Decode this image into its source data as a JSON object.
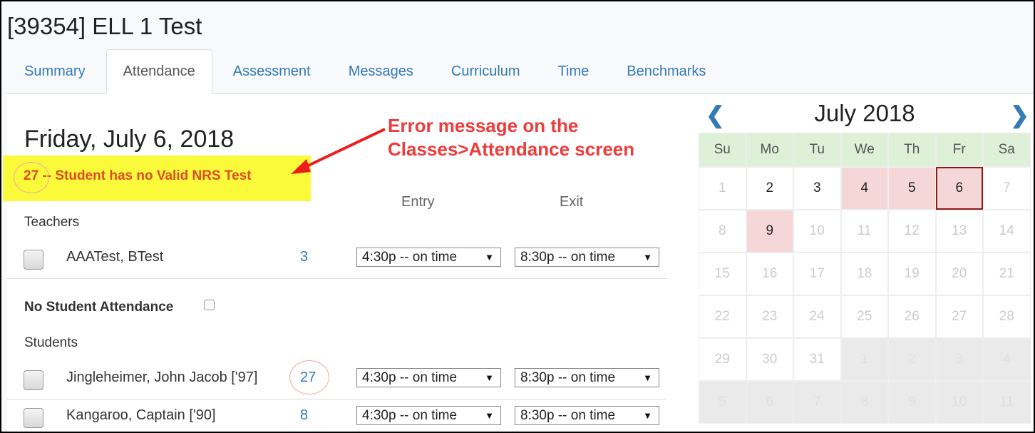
{
  "page_title": "[39354] ELL 1 Test",
  "tabs": [
    {
      "label": "Summary",
      "active": false
    },
    {
      "label": "Attendance",
      "active": true
    },
    {
      "label": "Assessment",
      "active": false
    },
    {
      "label": "Messages",
      "active": false
    },
    {
      "label": "Curriculum",
      "active": false
    },
    {
      "label": "Time",
      "active": false
    },
    {
      "label": "Benchmarks",
      "active": false
    }
  ],
  "attendance": {
    "date_heading": "Friday, July 6, 2018",
    "error_message": "27 -- Student has no Valid NRS Test",
    "column_entry": "Entry",
    "column_exit": "Exit",
    "teachers_label": "Teachers",
    "teachers": [
      {
        "name": "AAATest, BTest",
        "count": "3",
        "entry": "4:30p -- on time",
        "exit": "8:30p -- on time"
      }
    ],
    "no_student_attendance_label": "No Student Attendance",
    "students_label": "Students",
    "students": [
      {
        "name": "Jingleheimer, John Jacob ['97]",
        "count": "27",
        "entry": "4:30p -- on time",
        "exit": "8:30p -- on time"
      },
      {
        "name": "Kangaroo, Captain ['90]",
        "count": "8",
        "entry": "4:30p -- on time",
        "exit": "8:30p -- on time"
      }
    ]
  },
  "annotation": {
    "line1": "Error message on the",
    "line2": "Classes>Attendance screen",
    "color": "#ee3b3b"
  },
  "calendar": {
    "title": "July 2018",
    "prev_icon": "chevron-left-icon",
    "next_icon": "chevron-right-icon",
    "weekdays": [
      "Su",
      "Mo",
      "Tu",
      "We",
      "Th",
      "Fr",
      "Sa"
    ],
    "weeks": [
      [
        {
          "d": "1",
          "s": "cur-dim"
        },
        {
          "d": "2",
          "s": "cur"
        },
        {
          "d": "3",
          "s": "cur"
        },
        {
          "d": "4",
          "s": "pink"
        },
        {
          "d": "5",
          "s": "pink"
        },
        {
          "d": "6",
          "s": "selected"
        },
        {
          "d": "7",
          "s": "dim"
        }
      ],
      [
        {
          "d": "8",
          "s": "dim"
        },
        {
          "d": "9",
          "s": "pink"
        },
        {
          "d": "10",
          "s": "dim"
        },
        {
          "d": "11",
          "s": "dim"
        },
        {
          "d": "12",
          "s": "dim"
        },
        {
          "d": "13",
          "s": "dim"
        },
        {
          "d": "14",
          "s": "dim"
        }
      ],
      [
        {
          "d": "15",
          "s": "dim"
        },
        {
          "d": "16",
          "s": "dim"
        },
        {
          "d": "17",
          "s": "dim"
        },
        {
          "d": "18",
          "s": "dim"
        },
        {
          "d": "19",
          "s": "dim"
        },
        {
          "d": "20",
          "s": "dim"
        },
        {
          "d": "21",
          "s": "dim"
        }
      ],
      [
        {
          "d": "22",
          "s": "dim"
        },
        {
          "d": "23",
          "s": "dim"
        },
        {
          "d": "24",
          "s": "dim"
        },
        {
          "d": "25",
          "s": "dim"
        },
        {
          "d": "26",
          "s": "dim"
        },
        {
          "d": "27",
          "s": "dim"
        },
        {
          "d": "28",
          "s": "dim"
        }
      ],
      [
        {
          "d": "29",
          "s": "dim"
        },
        {
          "d": "30",
          "s": "dim"
        },
        {
          "d": "31",
          "s": "dim"
        },
        {
          "d": "1",
          "s": "next-month"
        },
        {
          "d": "2",
          "s": "next-month"
        },
        {
          "d": "3",
          "s": "next-month"
        },
        {
          "d": "4",
          "s": "next-month"
        }
      ],
      [
        {
          "d": "5",
          "s": "next-month"
        },
        {
          "d": "6",
          "s": "next-month"
        },
        {
          "d": "7",
          "s": "next-month"
        },
        {
          "d": "8",
          "s": "next-month"
        },
        {
          "d": "9",
          "s": "next-month"
        },
        {
          "d": "10",
          "s": "next-month"
        },
        {
          "d": "11",
          "s": "next-month"
        }
      ]
    ],
    "highlight_color": "#f6d7d7",
    "header_color": "#dff0d8"
  }
}
